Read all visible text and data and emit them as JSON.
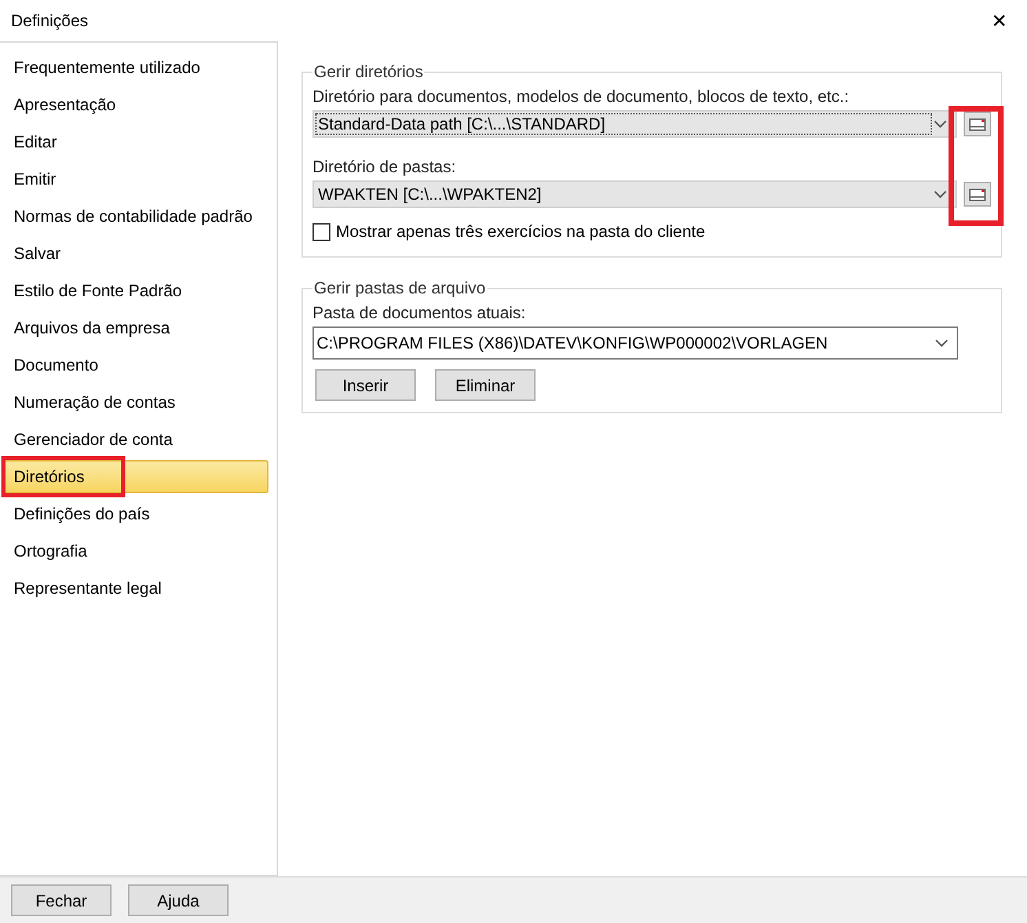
{
  "window": {
    "title": "Definições",
    "close": "✕"
  },
  "sidebar": {
    "items": [
      {
        "label": "Frequentemente utilizado",
        "selected": false,
        "highlighted": false
      },
      {
        "label": "Apresentação",
        "selected": false,
        "highlighted": false
      },
      {
        "label": "Editar",
        "selected": false,
        "highlighted": false
      },
      {
        "label": "Emitir",
        "selected": false,
        "highlighted": false
      },
      {
        "label": "Normas de contabilidade padrão",
        "selected": false,
        "highlighted": false
      },
      {
        "label": "Salvar",
        "selected": false,
        "highlighted": false
      },
      {
        "label": "Estilo de Fonte Padrão",
        "selected": false,
        "highlighted": false
      },
      {
        "label": "Arquivos da empresa",
        "selected": false,
        "highlighted": false
      },
      {
        "label": "Documento",
        "selected": false,
        "highlighted": false
      },
      {
        "label": "Numeração de contas",
        "selected": false,
        "highlighted": false
      },
      {
        "label": "Gerenciador de conta",
        "selected": false,
        "highlighted": false
      },
      {
        "label": "Diretórios",
        "selected": true,
        "highlighted": true
      },
      {
        "label": "Definições do país",
        "selected": false,
        "highlighted": false
      },
      {
        "label": "Ortografia",
        "selected": false,
        "highlighted": false
      },
      {
        "label": "Representante legal",
        "selected": false,
        "highlighted": false
      }
    ]
  },
  "directories_group": {
    "legend": "Gerir diretórios",
    "browse_highlighted": true,
    "fields": [
      {
        "label": "Diretório para documentos, modelos de documento, blocos de texto, etc.:",
        "value": "Standard-Data path [C:\\...\\STANDARD]",
        "focused": true
      },
      {
        "label": "Diretório de pastas:",
        "value": "WPAKTEN [C:\\...\\WPAKTEN2]",
        "focused": false
      }
    ],
    "checkbox": {
      "label": "Mostrar apenas três exercícios na pasta do cliente",
      "checked": false
    }
  },
  "archive_group": {
    "legend": "Gerir pastas de arquivo",
    "label": "Pasta de documentos atuais:",
    "value": "C:\\PROGRAM FILES (X86)\\DATEV\\KONFIG\\WP000002\\VORLAGEN",
    "buttons": [
      "Inserir",
      "Eliminar"
    ]
  },
  "footer_buttons": [
    "Fechar",
    "Ajuda"
  ]
}
